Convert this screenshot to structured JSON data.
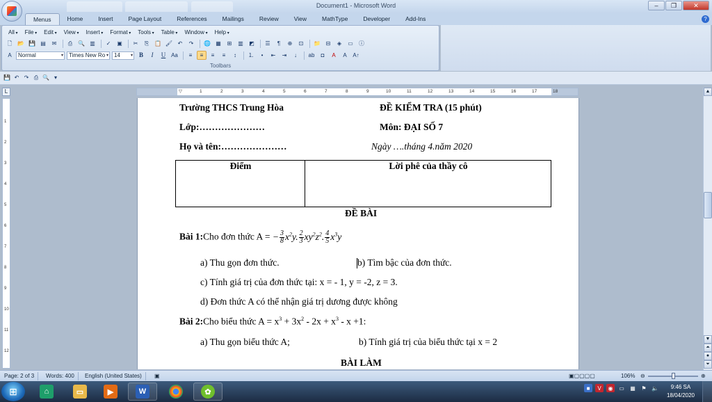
{
  "window": {
    "title": "Document1 - Microsoft Word",
    "controls": [
      "–",
      "❐",
      "✕"
    ]
  },
  "ribbon_tabs": [
    "Menus",
    "Home",
    "Insert",
    "Page Layout",
    "References",
    "Mailings",
    "Review",
    "View",
    "MathType",
    "Developer",
    "Add-Ins"
  ],
  "active_tab": "Menus",
  "menu_bar": [
    "All",
    "File",
    "Edit",
    "View",
    "Insert",
    "Format",
    "Tools",
    "Table",
    "Window",
    "Help"
  ],
  "toolbar": {
    "style_value": "Normal",
    "font_value": "Times New Ro",
    "size_value": "14",
    "group_label": "Toolbars"
  },
  "document": {
    "school": "Trường THCS Trung Hòa",
    "exam_title": "ĐỀ KIỂM TRA (15 phút)",
    "class_label": "Lớp:…………………",
    "subject": "Môn: ĐẠI SỐ 7",
    "name_label": "Họ và tên:…………………",
    "date": "Ngày ….tháng 4.năm 2020",
    "table_headers": [
      "Điểm",
      "Lời phê của thầy cô"
    ],
    "section_title": "ĐỀ BÀI",
    "q1_label": "Bài 1:",
    "q1_text": "Cho đơn thức A = ",
    "q1_a": "a) Thu gọn đơn thức.",
    "q1_b": "b) Tìm bậc của đơn thức.",
    "q1_c": "c) Tính giá trị của đơn thức tại: x = - 1, y = -2, z = 3.",
    "q1_d": "d) Đơn thức A có thể nhận giá trị dương được không",
    "q2_label": "Bài 2:",
    "q2_text_pre": "Cho biểu thức A = x",
    "q2_text_rest": " + 3x",
    "q2_text_rest2": " - 2x + x",
    "q2_text_rest3": " - x +1:",
    "q2_a": "a) Thu gọn biểu thức A;",
    "q2_b": "b) Tính giá trị của biểu thức tại x = 2",
    "answer_title": "BÀI LÀM",
    "formula": {
      "sign": "−",
      "f1_num": "3",
      "f1_den": "8",
      "m1": "x",
      "m1b": "y.",
      "f2_num": "2",
      "f2_den": "3",
      "m2": "xy",
      "m2b": "z",
      "m2c": ".",
      "f3_num": "4",
      "f3_den": "5",
      "m3": "x",
      "m3b": "y"
    },
    "exp_2": "2",
    "exp_3": "3"
  },
  "status_bar": {
    "page": "Page: 2 of 3",
    "words": "Words: 400",
    "language": "English (United States)",
    "zoom": "106%"
  },
  "taskbar": {
    "time": "9:46 SA",
    "date": "18/04/2020"
  },
  "colors": {
    "accent": "#2e6ad0",
    "ribbon": "#dfe9f5",
    "taskbar": "#1c2c43"
  }
}
